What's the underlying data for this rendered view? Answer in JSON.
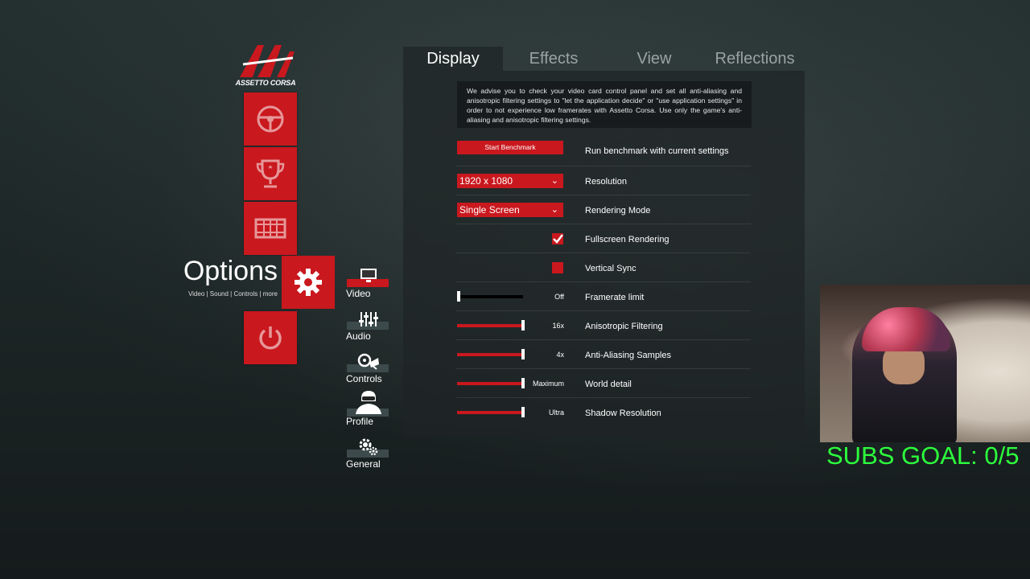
{
  "logo": {
    "text": "ASSETTO CORSA"
  },
  "options": {
    "title": "Options",
    "subtitle": "Video | Sound | Controls | more"
  },
  "main_menu": [
    {
      "icon": "steering-wheel-icon"
    },
    {
      "icon": "trophy-icon"
    },
    {
      "icon": "replay-film-icon"
    },
    {
      "icon": "options-gear-icon"
    },
    {
      "icon": "power-icon"
    }
  ],
  "submenu": [
    {
      "label": "Video",
      "icon": "monitor-icon",
      "active": true
    },
    {
      "label": "Audio",
      "icon": "mixer-icon"
    },
    {
      "label": "Controls",
      "icon": "controls-icon"
    },
    {
      "label": "Profile",
      "icon": "helmet-icon"
    },
    {
      "label": "General",
      "icon": "gears-icon"
    }
  ],
  "tabs": [
    "Display",
    "Effects",
    "View",
    "Reflections"
  ],
  "active_tab": "Display",
  "advice": "We advise you to check your video card control panel and set all anti-aliasing and anisotropic filtering settings to \"let the application decide\" or \"use application settings\" in order to not experience low framerates with Assetto Corsa. Use only the game's anti-aliasing and anisotropic filtering settings.",
  "settings": {
    "benchmark": {
      "button": "Start Benchmark",
      "label": "Run benchmark with current settings"
    },
    "resolution": {
      "value": "1920 x 1080",
      "label": "Resolution"
    },
    "rendering_mode": {
      "value": "Single Screen",
      "label": "Rendering Mode"
    },
    "fullscreen": {
      "label": "Fullscreen Rendering",
      "checked": true
    },
    "vsync": {
      "label": "Vertical Sync",
      "checked": false
    },
    "framerate_limit": {
      "label": "Framerate limit",
      "value": "Off",
      "level": 0
    },
    "anisotropic": {
      "label": "Anisotropic Filtering",
      "value": "16x",
      "level": 1
    },
    "antialiasing": {
      "label": "Anti-Aliasing Samples",
      "value": "4x",
      "level": 1
    },
    "world_detail": {
      "label": "World detail",
      "value": "Maximum",
      "level": 1
    },
    "shadow_resolution": {
      "label": "Shadow Resolution",
      "value": "Ultra",
      "level": 1
    }
  },
  "overlay": {
    "subs_goal": "SUBS GOAL: 0/5"
  },
  "colors": {
    "accent": "#c9181e",
    "subs_text": "#2cff3d"
  }
}
